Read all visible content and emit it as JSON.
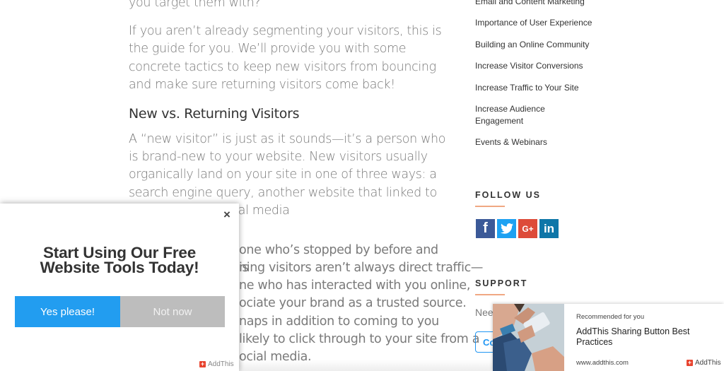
{
  "article": {
    "intro_tail": "you target them with?",
    "paragraph_1": "If you aren’t already segmenting your visitors, this is the guide for you. We’ll provide you with some concrete tactics to keep new visitors from bouncing and make sure returning visitors come back!",
    "heading": "New vs. Returning Visitors",
    "paragraph_2": "A “new visitor” is just as it sounds—it’s a person who is brand-new to your website. New visitors usually organically land on your site in one of three ways: a search engine query, another website that linked to your site, or a social media",
    "paragraph_3_visible": "one who’s stopped by before and is ning visitors aren’t always direct traffic— ne who has interacted with you online, ociate your brand as a trusted source. naps in addition to coming to you likely to click through to your site from a ocial media."
  },
  "sidebar": {
    "topics": [
      "Email and Content Marketing",
      "Importance of User Experience",
      "Building an Online Community",
      "Increase Visitor Conversions",
      "Increase Traffic to Your Site",
      "Increase Audience Engagement",
      "Events & Webinars"
    ],
    "follow_title": "FOLLOW US",
    "social": [
      {
        "name": "facebook",
        "glyph": "f",
        "color": "#3b5998"
      },
      {
        "name": "twitter",
        "glyph": "🐦",
        "color": "#1da1f2"
      },
      {
        "name": "google-plus",
        "glyph": "G+",
        "color": "#dd4b39"
      },
      {
        "name": "linkedin",
        "glyph": "in",
        "color": "#0e76a8"
      }
    ],
    "support_title": "SUPPORT",
    "support_text_visible": "Nee",
    "contact_button_visible": "Co"
  },
  "popup": {
    "close": "×",
    "title_line_1": "Start Using Our Free",
    "title_line_2": "Website Tools Today!",
    "yes_label": "Yes please!",
    "no_label": "Not now",
    "brand_logo": "+",
    "brand": "AddThis",
    "yes_color": "#229df0",
    "no_color": "#bdbdbd"
  },
  "recommendation": {
    "label": "Recommended for you",
    "title": "AddThis Sharing Button Best Practices",
    "url": "www.addthis.com",
    "brand_logo": "+",
    "brand": "AddThis"
  }
}
